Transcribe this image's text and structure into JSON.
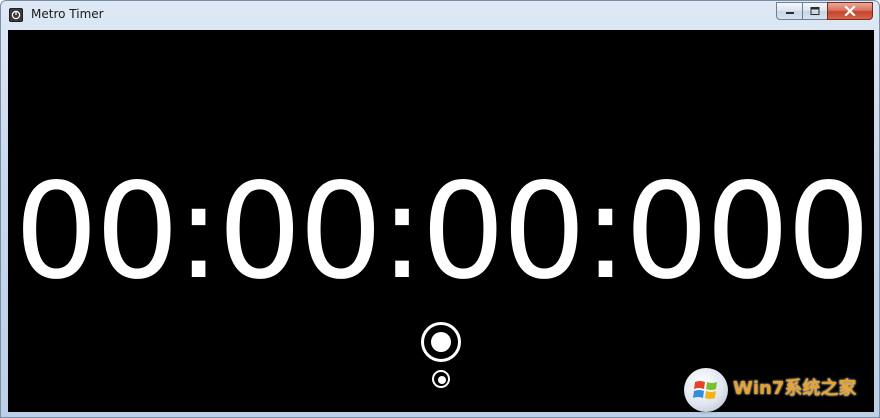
{
  "window": {
    "title": "Metro Timer",
    "icon": "app-timer-icon",
    "caption_icons": [
      "minimize-icon",
      "maximize-icon",
      "close-icon"
    ]
  },
  "timer": {
    "display": "00:00:00:000"
  },
  "controls": {
    "start_icon": "start-circle-icon",
    "reset_icon": "reset-circle-icon"
  },
  "watermark": {
    "text": "Win7系统之家",
    "logo_icon": "windows-logo-icon"
  },
  "colors": {
    "background": "#000000",
    "digits": "#ffffff",
    "watermark_text": "#e8a22a"
  }
}
